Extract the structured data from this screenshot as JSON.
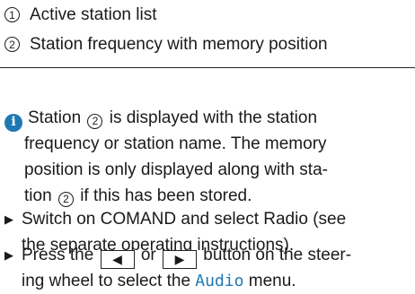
{
  "legend": [
    {
      "num": "1",
      "text": "Active station list"
    },
    {
      "num": "2",
      "text": "Station frequency with memory position"
    }
  ],
  "note": {
    "icon": "info-icon",
    "line1_a": "Station",
    "line1_num": "2",
    "line1_b": "is displayed with the station",
    "line2": "frequency or station name. The memory",
    "line3": "position is only displayed along with sta-",
    "line4_a": "tion",
    "line4_num": "2",
    "line4_b": "if this has been stored."
  },
  "steps": [
    {
      "line1": "Switch on COMAND and select Radio (see",
      "line2": "the separate operating instructions)."
    },
    {
      "line1_a": "Press the",
      "key_left": "◀",
      "line1_or": "or",
      "key_right": "▶",
      "line1_b": "button on the steer-",
      "line2_a": "ing wheel to select the",
      "menu_name": "Audio",
      "line2_b": "menu."
    }
  ],
  "colors": {
    "accent": "#1f78b4",
    "text": "#1a1a1a"
  }
}
